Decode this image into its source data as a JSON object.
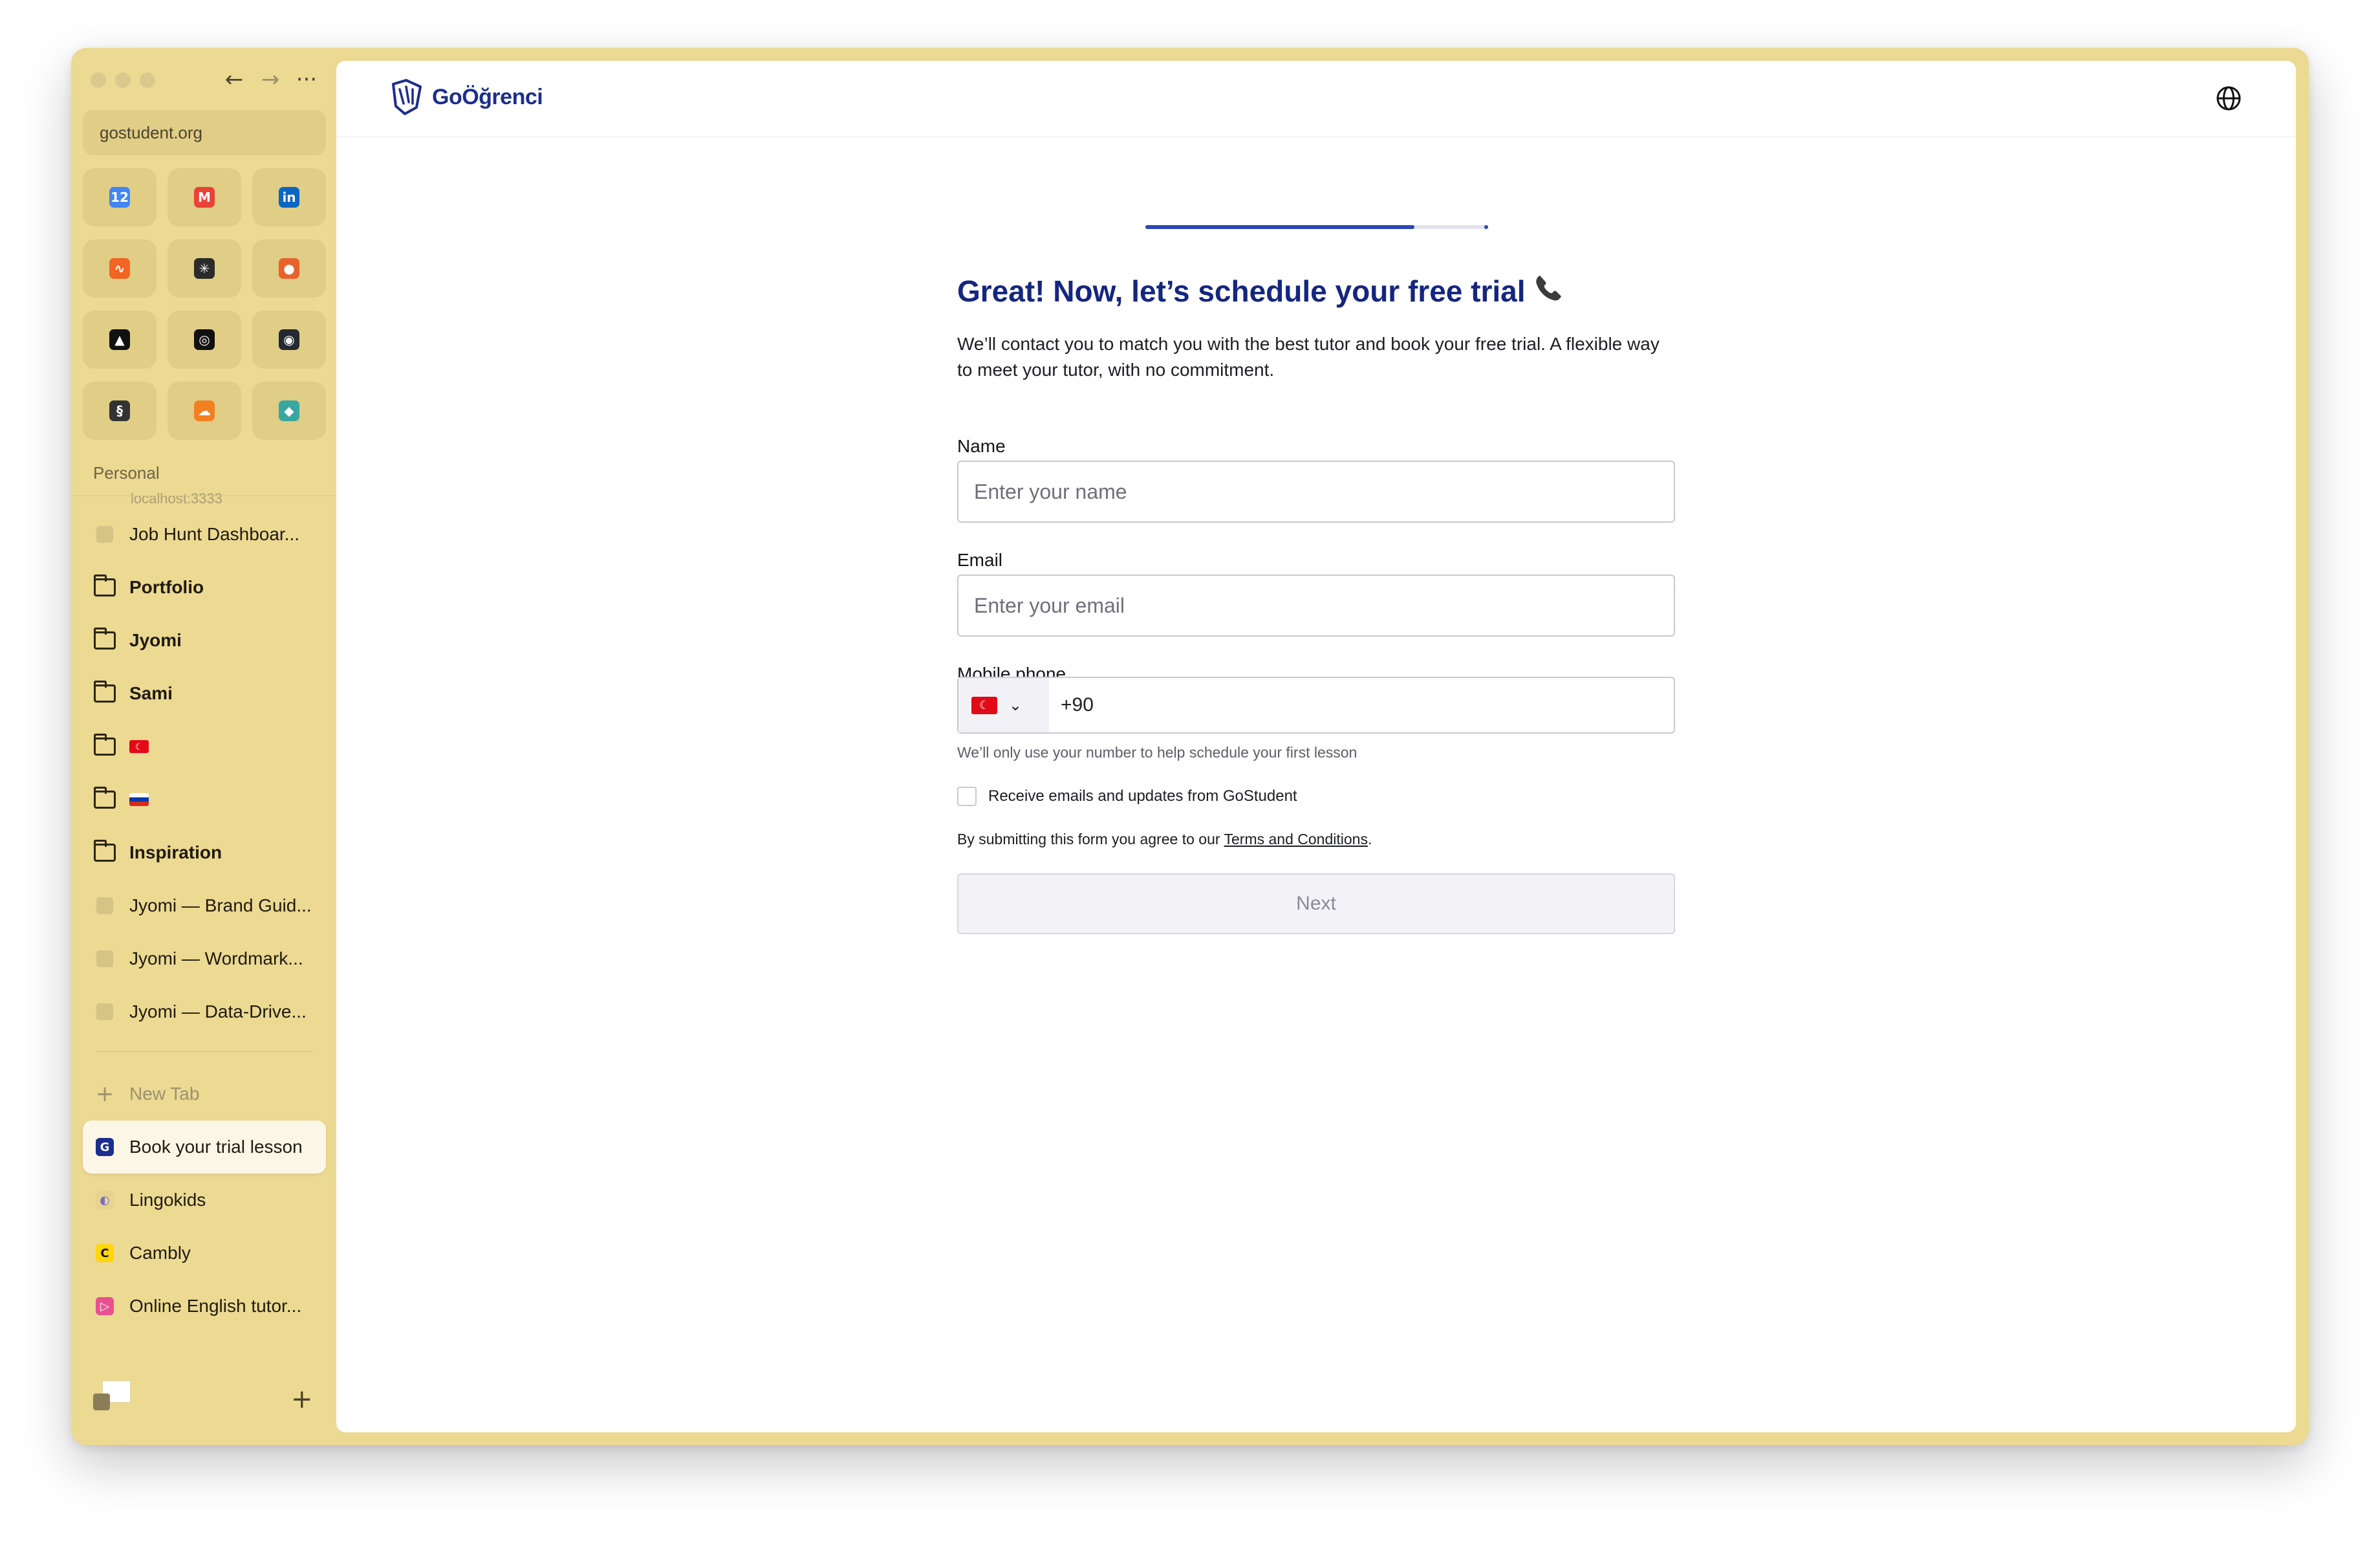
{
  "browser": {
    "url": "gostudent.org",
    "nav": {
      "back": "←",
      "forward": "→",
      "more": "···"
    },
    "favorites": [
      {
        "icon": "calendar-icon",
        "glyph": "12",
        "bg": "#4285f4"
      },
      {
        "icon": "gmail-icon",
        "glyph": "M",
        "bg": "#ea4335"
      },
      {
        "icon": "linkedin-icon",
        "glyph": "in",
        "bg": "#0a66c2"
      },
      {
        "icon": "analytics-icon",
        "glyph": "∿",
        "bg": "#f26522"
      },
      {
        "icon": "asterisk-app-icon",
        "glyph": "✳",
        "bg": "#2b2b2b"
      },
      {
        "icon": "orange-app-icon",
        "glyph": "●",
        "bg": "#e8622c"
      },
      {
        "icon": "vercel-icon",
        "glyph": "▲",
        "bg": "#111111"
      },
      {
        "icon": "chatgpt-icon",
        "glyph": "◎",
        "bg": "#111111"
      },
      {
        "icon": "github-icon",
        "glyph": "◉",
        "bg": "#24292f"
      },
      {
        "icon": "squarespace-icon",
        "glyph": "§",
        "bg": "#333333"
      },
      {
        "icon": "cloudflare-icon",
        "glyph": "☁",
        "bg": "#f38020"
      },
      {
        "icon": "diamond-app-icon",
        "glyph": "◆",
        "bg": "#3aa6a0"
      }
    ],
    "section_label": "Personal",
    "ghost_item": "localhost:3333",
    "items": [
      {
        "type": "page",
        "label": "Job Hunt Dashboar..."
      },
      {
        "type": "folder",
        "label": "Portfolio"
      },
      {
        "type": "folder",
        "label": "Jyomi"
      },
      {
        "type": "folder",
        "label": "Sami"
      },
      {
        "type": "folder-flag-tr",
        "label": ""
      },
      {
        "type": "folder-flag-ru",
        "label": ""
      },
      {
        "type": "folder",
        "label": "Inspiration"
      },
      {
        "type": "page",
        "label": "Jyomi — Brand Guid..."
      },
      {
        "type": "page",
        "label": "Jyomi — Wordmark..."
      },
      {
        "type": "page",
        "label": "Jyomi — Data-Drive..."
      }
    ],
    "new_tab_label": "New Tab",
    "tabs": [
      {
        "label": "Book your trial lesson",
        "active": true,
        "icon_bg": "#1b2d8e",
        "icon_color": "#ffffff",
        "glyph": "G"
      },
      {
        "label": "Lingokids",
        "active": false,
        "icon_bg": "#e6d48e",
        "icon_color": "#7a6cc4",
        "glyph": "◐"
      },
      {
        "label": "Cambly",
        "active": false,
        "icon_bg": "#ffd60a",
        "icon_color": "#111111",
        "glyph": "C"
      },
      {
        "label": "Online English tutor...",
        "active": false,
        "icon_bg": "#e9508f",
        "icon_color": "#ffffff",
        "glyph": "▷"
      }
    ]
  },
  "page": {
    "logo_text": "GoÖğrenci",
    "progress_fraction": 0.785,
    "title": "Great! Now, let’s schedule your free trial",
    "subtitle": "We’ll contact you to match you with the best tutor and book your free trial. A flexible way to meet your tutor, with no commitment.",
    "name_label": "Name",
    "name_placeholder": "Enter your name",
    "email_label": "Email",
    "email_placeholder": "Enter your email",
    "phone_label": "Mobile phone",
    "phone_country_flag": "☾",
    "phone_dial_code": "+90",
    "phone_hint": "We’ll only use your number to help schedule your first lesson",
    "checkbox_label": "Receive emails and updates from GoStudent",
    "terms_prefix": "By submitting this form you agree to our ",
    "terms_link": "Terms and Conditions",
    "terms_suffix": ".",
    "next_label": "Next",
    "colors": {
      "brand": "#15267f",
      "accent": "#2b45b8",
      "sidebar_bg": "#ecd992"
    }
  }
}
